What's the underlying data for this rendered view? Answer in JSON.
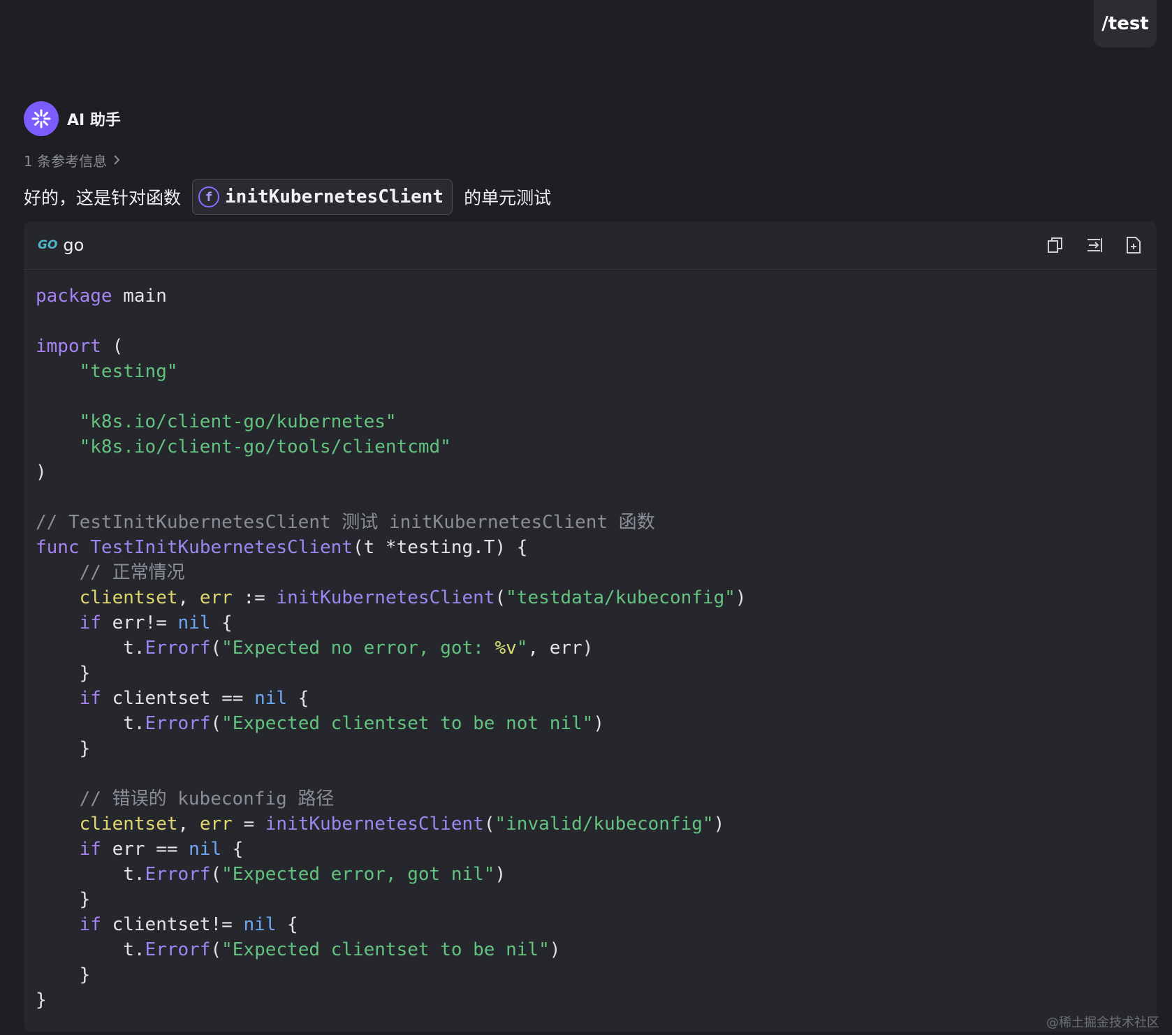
{
  "command_chip": "/test",
  "assistant": {
    "name": "AI 助手",
    "references": "1 条参考信息"
  },
  "message": {
    "prefix": "好的，这是针对函数",
    "function_icon": "f",
    "function_name": "initKubernetesClient",
    "suffix": "的单元测试"
  },
  "code_block": {
    "language_icon": "GO",
    "language": "go",
    "toolbar": [
      "copy-icon",
      "insert-icon",
      "new-file-icon"
    ],
    "lines": [
      "package main",
      "",
      "import (",
      "    \"testing\"",
      "",
      "    \"k8s.io/client-go/kubernetes\"",
      "    \"k8s.io/client-go/tools/clientcmd\"",
      ")",
      "",
      "// TestInitKubernetesClient 测试 initKubernetesClient 函数",
      "func TestInitKubernetesClient(t *testing.T) {",
      "    // 正常情况",
      "    clientset, err := initKubernetesClient(\"testdata/kubeconfig\")",
      "    if err!= nil {",
      "        t.Errorf(\"Expected no error, got: %v\", err)",
      "    }",
      "    if clientset == nil {",
      "        t.Errorf(\"Expected clientset to be not nil\")",
      "    }",
      "",
      "    // 错误的 kubeconfig 路径",
      "    clientset, err = initKubernetesClient(\"invalid/kubeconfig\")",
      "    if err == nil {",
      "        t.Errorf(\"Expected error, got nil\")",
      "    }",
      "    if clientset!= nil {",
      "        t.Errorf(\"Expected clientset to be nil\")",
      "    }",
      "}"
    ]
  },
  "watermark": "@稀土掘金技术社区"
}
